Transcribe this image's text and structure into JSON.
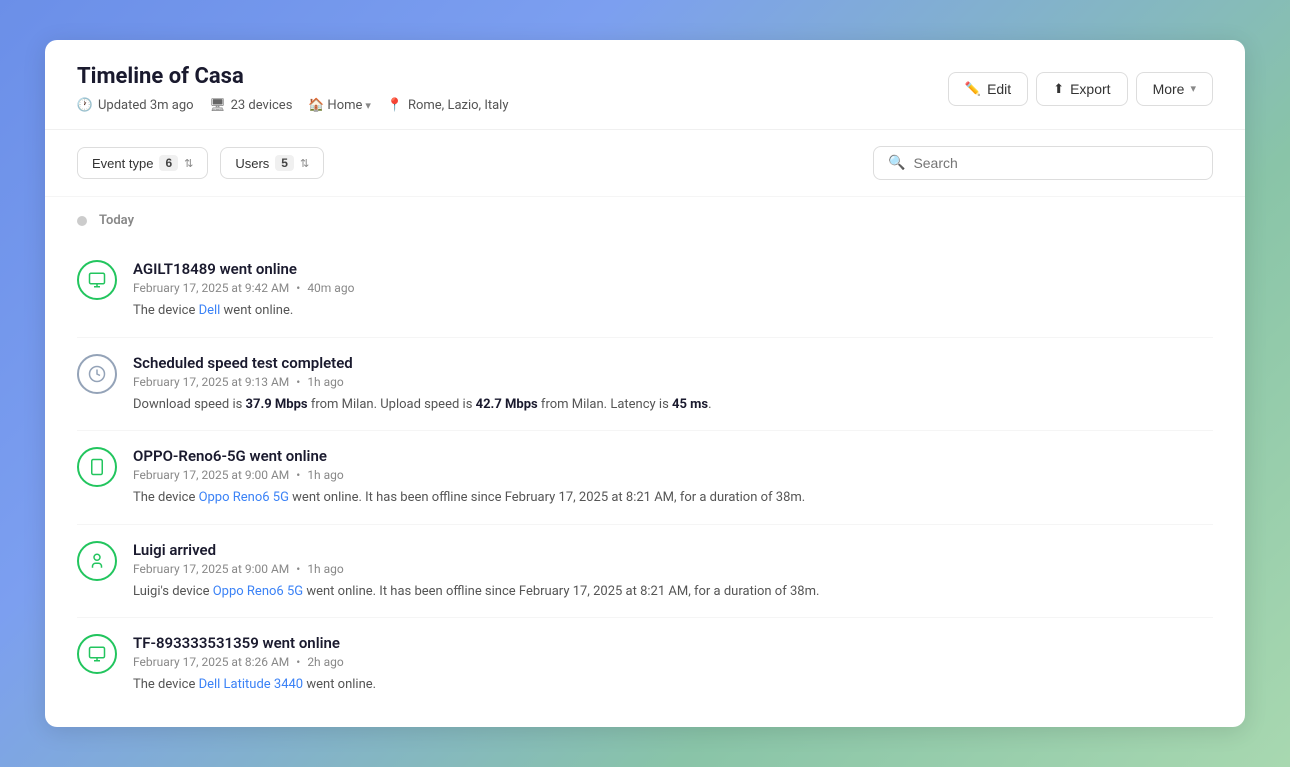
{
  "page": {
    "title": "Timeline of Casa"
  },
  "header": {
    "meta": {
      "updated": "Updated 3m ago",
      "devices": "23 devices",
      "home": "Home",
      "location": "Rome, Lazio, Italy"
    },
    "actions": {
      "edit_label": "Edit",
      "export_label": "Export",
      "more_label": "More"
    }
  },
  "toolbar": {
    "event_type_label": "Event type",
    "event_type_count": "6",
    "users_label": "Users",
    "users_count": "5",
    "search_placeholder": "Search"
  },
  "timeline": {
    "date_label": "Today",
    "items": [
      {
        "id": "1",
        "icon_type": "monitor",
        "title": "AGILT18489 went online",
        "date": "February 17, 2025 at 9:42 AM",
        "ago": "40m ago",
        "desc_prefix": "The device ",
        "desc_link": "Dell",
        "desc_suffix": " went online.",
        "desc_link2": null,
        "desc_suffix2": null
      },
      {
        "id": "2",
        "icon_type": "speed",
        "title": "Scheduled speed test completed",
        "date": "February 17, 2025 at 9:13 AM",
        "ago": "1h ago",
        "desc_plain": "Download speed is ",
        "desc_bold1": "37.9 Mbps",
        "desc_mid1": " from Milan. Upload speed is ",
        "desc_bold2": "42.7 Mbps",
        "desc_mid2": " from Milan. Latency is ",
        "desc_bold3": "45 ms",
        "desc_end": ".",
        "type": "speed"
      },
      {
        "id": "3",
        "icon_type": "monitor",
        "title": "OPPO-Reno6-5G went online",
        "date": "February 17, 2025 at 9:00 AM",
        "ago": "1h ago",
        "desc_prefix": "The device ",
        "desc_link": "Oppo Reno6 5G",
        "desc_suffix": " went online. It has been offline since February 17, 2025 at 8:21 AM, for a duration of 38m."
      },
      {
        "id": "4",
        "icon_type": "person",
        "title": "Luigi arrived",
        "date": "February 17, 2025 at 9:00 AM",
        "ago": "1h ago",
        "desc_prefix": "Luigi's device ",
        "desc_link": "Oppo Reno6 5G",
        "desc_suffix": " went online. It has been offline since February 17, 2025 at 8:21 AM, for a duration of 38m."
      },
      {
        "id": "5",
        "icon_type": "monitor",
        "title": "TF-893333531359 went online",
        "date": "February 17, 2025 at 8:26 AM",
        "ago": "2h ago",
        "desc_prefix": "The device ",
        "desc_link": "Dell Latitude 3440",
        "desc_suffix": " went online."
      }
    ]
  }
}
